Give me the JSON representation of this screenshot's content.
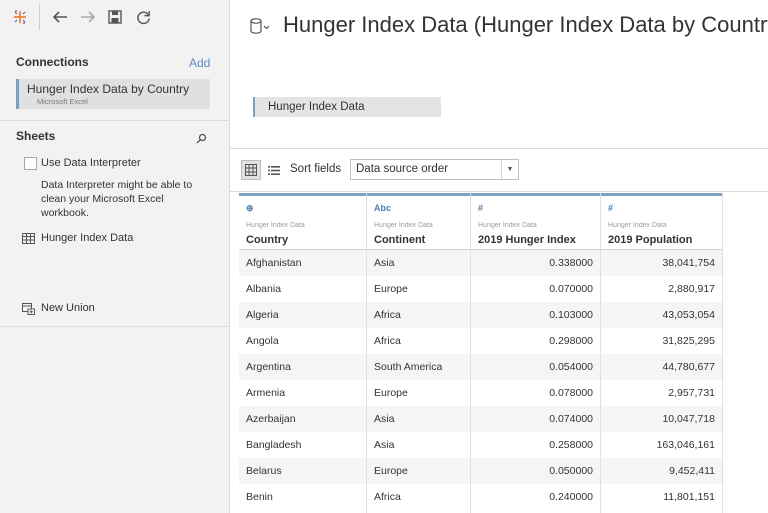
{
  "toolbar": {
    "icons": [
      "tableau-logo-icon",
      "back-arrow-icon",
      "forward-arrow-icon",
      "save-icon",
      "refresh-icon"
    ]
  },
  "connections": {
    "title": "Connections",
    "add_label": "Add",
    "item": {
      "name": "Hunger Index Data by Country",
      "type": "Microsoft Excel"
    }
  },
  "sheets": {
    "title": "Sheets",
    "use_interpreter_label": "Use Data Interpreter",
    "interpreter_note": "Data Interpreter might be able to clean your Microsoft Excel workbook.",
    "sheet_item": "Hunger Index Data",
    "new_union": "New Union"
  },
  "main": {
    "title": "Hunger Index Data (Hunger Index Data by Country)",
    "canvas_table": "Hunger Index Data",
    "sort_label": "Sort fields",
    "sort_value": "Data source order"
  },
  "grid": {
    "columns": [
      {
        "type_icon": "⊕",
        "source": "Hunger Index Data",
        "name": "Country",
        "align": "left"
      },
      {
        "type_icon": "Abc",
        "source": "Hunger Index Data",
        "name": "Continent",
        "align": "left"
      },
      {
        "type_icon": "#",
        "source": "Hunger Index Data",
        "name": "2019 Hunger Index",
        "align": "right"
      },
      {
        "type_icon": "#",
        "source": "Hunger Index Data",
        "name": "2019 Population",
        "align": "right"
      }
    ],
    "rows": [
      [
        "Afghanistan",
        "Asia",
        "0.338000",
        "38,041,754"
      ],
      [
        "Albania",
        "Europe",
        "0.070000",
        "2,880,917"
      ],
      [
        "Algeria",
        "Africa",
        "0.103000",
        "43,053,054"
      ],
      [
        "Angola",
        "Africa",
        "0.298000",
        "31,825,295"
      ],
      [
        "Argentina",
        "South America",
        "0.054000",
        "44,780,677"
      ],
      [
        "Armenia",
        "Europe",
        "0.078000",
        "2,957,731"
      ],
      [
        "Azerbaijan",
        "Asia",
        "0.074000",
        "10,047,718"
      ],
      [
        "Bangladesh",
        "Asia",
        "0.258000",
        "163,046,161"
      ],
      [
        "Belarus",
        "Europe",
        "0.050000",
        "9,452,411"
      ],
      [
        "Benin",
        "Africa",
        "0.240000",
        "11,801,151"
      ]
    ]
  },
  "colors": {
    "accent": "#7aa0c4",
    "link": "#5b8bc6",
    "sidebar_bg": "#f2f2f2",
    "row_alt": "#f5f5f5"
  }
}
